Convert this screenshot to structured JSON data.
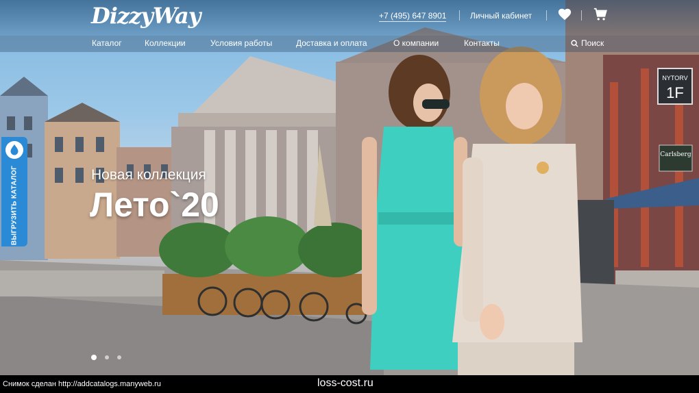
{
  "header": {
    "logo": "DizzyWay",
    "phone": "+7 (495) 647 8901",
    "account": "Личный кабинет",
    "favorites_icon": "heart-icon",
    "cart_icon": "cart-icon"
  },
  "nav": {
    "items": [
      "Каталог",
      "Коллекции",
      "Условия работы",
      "Доставка и оплата",
      "О компании",
      "Контакты"
    ],
    "search_label": "Поиск",
    "search_icon": "search-icon"
  },
  "sidetab": {
    "label": "ВЫГРУЗИТЬ КАТАЛОГ",
    "color": "#2a8ad6"
  },
  "hero": {
    "subtitle": "Новая коллекция",
    "title": "Лето`20",
    "slides": {
      "count": 3,
      "active": 1
    }
  },
  "signs": {
    "street": "NYTORV",
    "number": "1F",
    "beer": "Carlsberg"
  },
  "caption": {
    "left": "Снимок сделан http://addcatalogs.manyweb.ru",
    "center": "loss-cost.ru"
  },
  "colors": {
    "dress": "#3fcfc0",
    "accent": "#2a8ad6"
  }
}
